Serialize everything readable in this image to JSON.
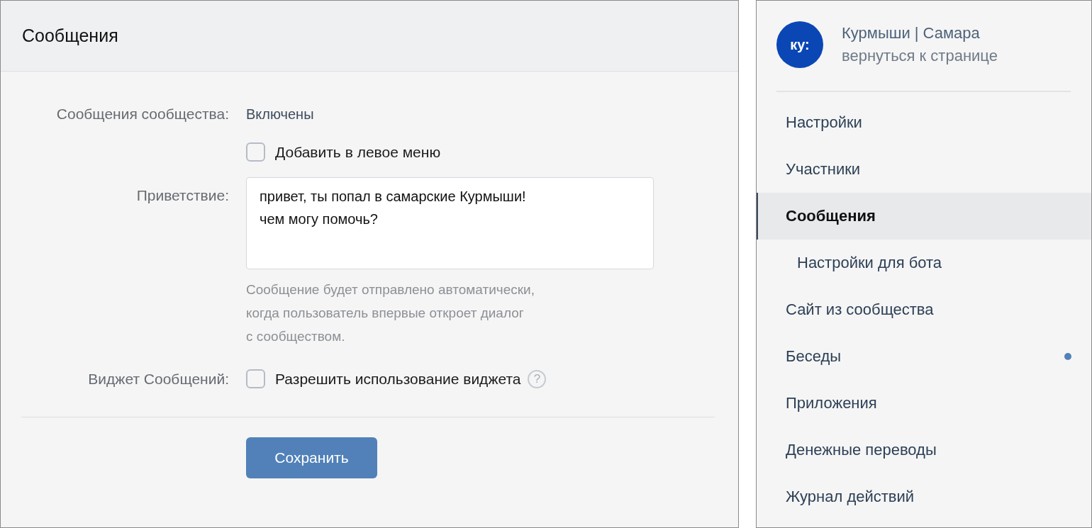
{
  "panel": {
    "title": "Сообщения"
  },
  "form": {
    "messages_label": "Сообщения сообщества:",
    "messages_value": "Включены",
    "left_menu_checkbox": {
      "label": "Добавить в левое меню",
      "checked": false
    },
    "greeting_label": "Приветствие:",
    "greeting_value": "привет, ты попал в самарские Курмыши!\nчем могу помочь?",
    "greeting_hint": "Сообщение будет отправлено автоматически,\nкогда пользователь впервые откроет диалог\nс сообществом.",
    "widget_label": "Виджет Сообщений:",
    "widget_checkbox": {
      "label": "Разрешить использование виджета",
      "checked": false
    },
    "help_icon": "?",
    "save_button": "Сохранить"
  },
  "sidebar": {
    "avatar": "ку:",
    "community_name": "Курмыши | Самара",
    "back_link": "вернуться к странице",
    "items": [
      {
        "label": "Настройки",
        "selected": false,
        "unread": false
      },
      {
        "label": "Участники",
        "selected": false,
        "unread": false
      },
      {
        "label": "Сообщения",
        "selected": true,
        "unread": false,
        "children": [
          {
            "label": "Настройки для бота",
            "selected": false,
            "unread": false
          }
        ]
      },
      {
        "label": "Сайт из сообщества",
        "selected": false,
        "unread": false
      },
      {
        "label": "Беседы",
        "selected": false,
        "unread": true
      },
      {
        "label": "Приложения",
        "selected": false,
        "unread": false
      },
      {
        "label": "Денежные переводы",
        "selected": false,
        "unread": false
      },
      {
        "label": "Журнал действий",
        "selected": false,
        "unread": false
      }
    ]
  }
}
